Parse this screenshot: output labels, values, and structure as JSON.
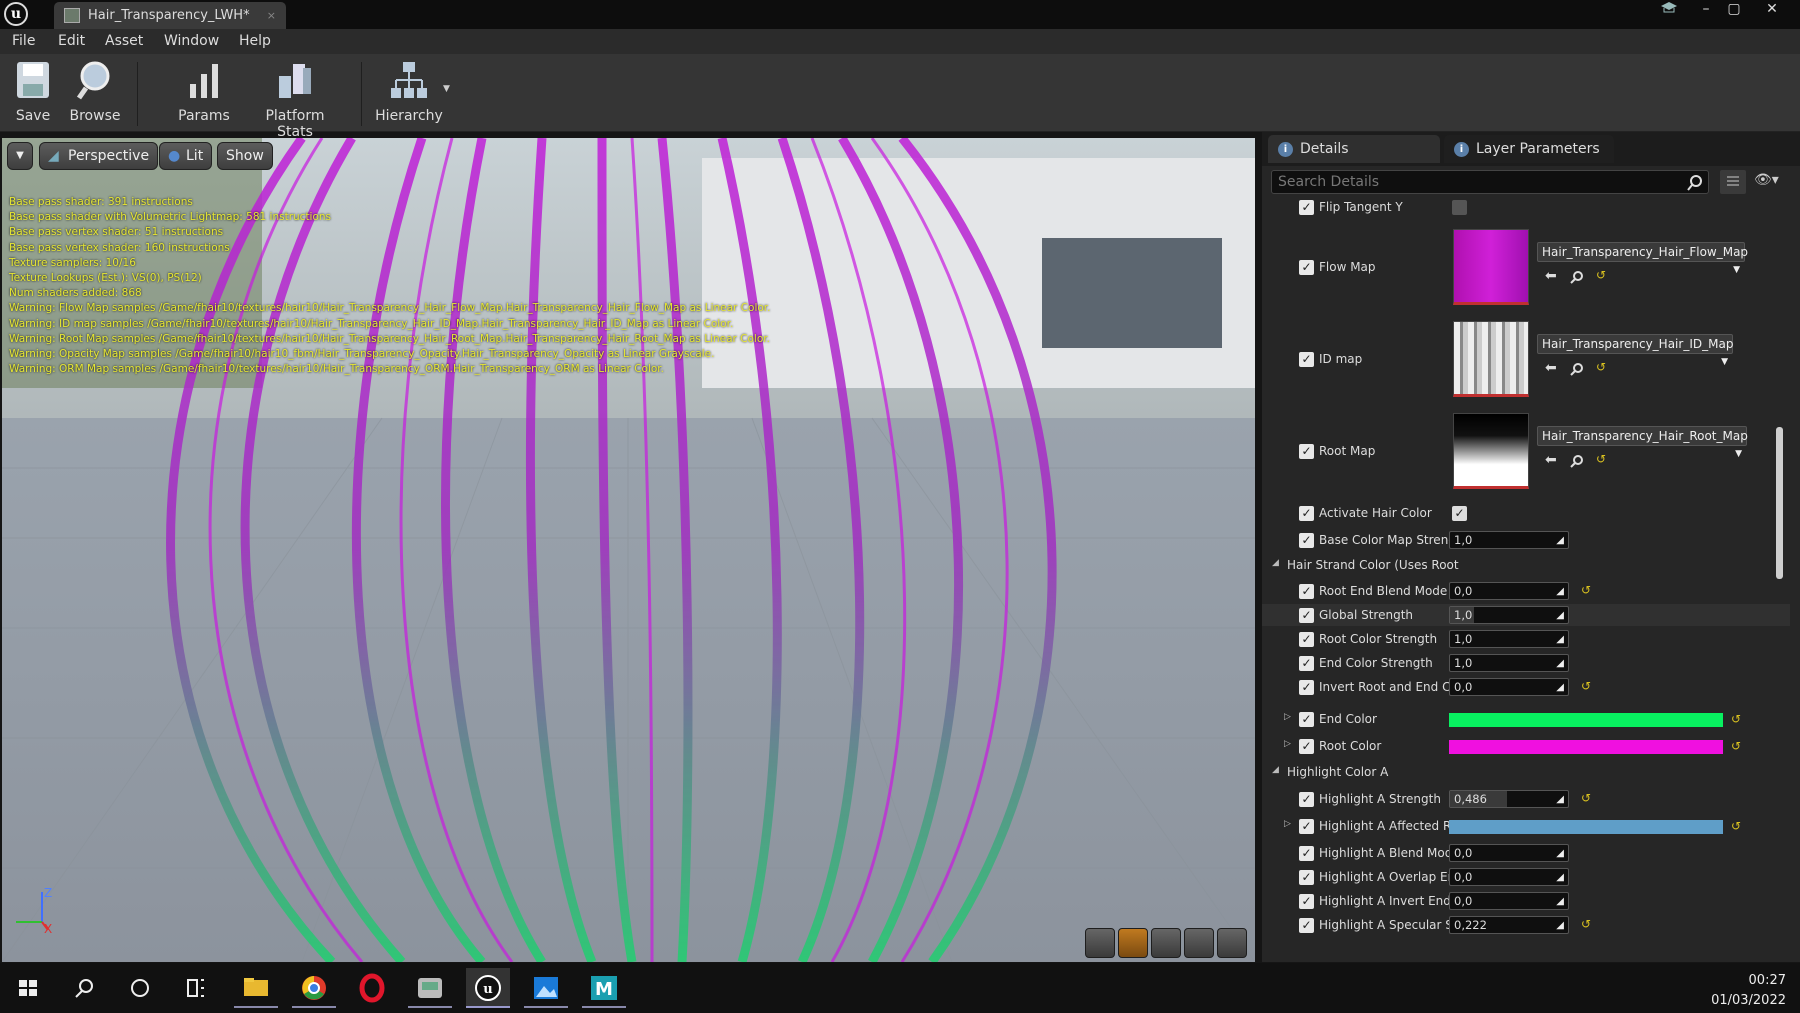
{
  "window": {
    "title": "Hair_Transparency_LWH*",
    "tab_close": "×",
    "minimize": "–",
    "restore": "▢",
    "close": "✕"
  },
  "menu": [
    "File",
    "Edit",
    "Asset",
    "Window",
    "Help"
  ],
  "toolbar": {
    "save": "Save",
    "browse": "Browse",
    "params": "Params",
    "platform_stats": "Platform Stats",
    "hierarchy": "Hierarchy"
  },
  "viewport": {
    "perspective": "Perspective",
    "lit": "Lit",
    "show": "Show",
    "stats": [
      "Base pass shader: 391 instructions",
      "Base pass shader with Volumetric Lightmap: 581 instructions",
      "Base pass vertex shader: 51 instructions",
      "Base pass vertex shader: 160 instructions",
      "Texture samplers: 10/16",
      "Texture Lookups (Est.): VS(0), PS(12)",
      "Num shaders added: 868",
      "Warning: Flow Map samples /Game/fhair10/textures/hair10/Hair_Transparency_Hair_Flow_Map.Hair_Transparency_Hair_Flow_Map as Linear Color.",
      "Warning: ID map samples /Game/fhair10/textures/hair10/Hair_Transparency_Hair_ID_Map.Hair_Transparency_Hair_ID_Map as Linear Color.",
      "Warning: Root Map samples /Game/fhair10/textures/hair10/Hair_Transparency_Hair_Root_Map.Hair_Transparency_Hair_Root_Map as Linear Color.",
      "Warning: Opacity Map samples /Game/fhair10/hair10_fbm/Hair_Transparency_Opacity.Hair_Transparency_Opacity as Linear Grayscale.",
      "Warning: ORM Map samples /Game/fhair10/textures/hair10/Hair_Transparency_ORM.Hair_Transparency_ORM as Linear Color."
    ],
    "axis_z": "Z",
    "axis_x": "X"
  },
  "details": {
    "tab_details": "Details",
    "tab_layers": "Layer Parameters",
    "search_placeholder": "Search Details",
    "flip_tangent": "Flip Tangent Y",
    "flow_map": "Flow Map",
    "flow_map_tex": "Hair_Transparency_Hair_Flow_Map",
    "id_map": "ID map",
    "id_map_tex": "Hair_Transparency_Hair_ID_Map",
    "root_map": "Root Map",
    "root_map_tex": "Hair_Transparency_Hair_Root_Map",
    "activate_hair_color": "Activate Hair Color",
    "base_color_map": "Base Color Map Strength",
    "base_color_map_val": "1,0",
    "cat_strand": "Hair Strand Color (Uses Root Map)",
    "params": [
      {
        "label": "Root End Blend Mode",
        "value": "0,0",
        "fill": 0.0
      },
      {
        "label": "Global Strength",
        "value": "1,0",
        "fill": 0.2
      },
      {
        "label": "Root Color Strength",
        "value": "1,0",
        "fill": 0.0
      },
      {
        "label": "End Color Strength",
        "value": "1,0",
        "fill": 0.0
      },
      {
        "label": "Invert Root and End Color",
        "value": "0,0",
        "fill": 0.0
      }
    ],
    "end_color": "End Color",
    "end_color_hex": "#08f060",
    "root_color": "Root Color",
    "root_color_hex": "#f010e0",
    "cat_highlight": "Highlight Color A",
    "highlight_strength": "Highlight A Strength",
    "highlight_strength_val": "0,486",
    "highlight_strength_fill": 0.486,
    "highlight_affected": "Highlight A Affected Range",
    "highlight_affected_hex": "#5f9ec8",
    "hparams": [
      {
        "label": "Highlight A Blend Mode",
        "value": "0,0"
      },
      {
        "label": "Highlight A Overlap End",
        "value": "0,0"
      },
      {
        "label": "Highlight A Invert End to Root",
        "value": "0,0"
      },
      {
        "label": "Highlight A Specular Strength",
        "value": "0,222"
      }
    ],
    "reset": "↺"
  },
  "taskbar": {
    "time": "00:27",
    "date": "01/03/2022"
  }
}
